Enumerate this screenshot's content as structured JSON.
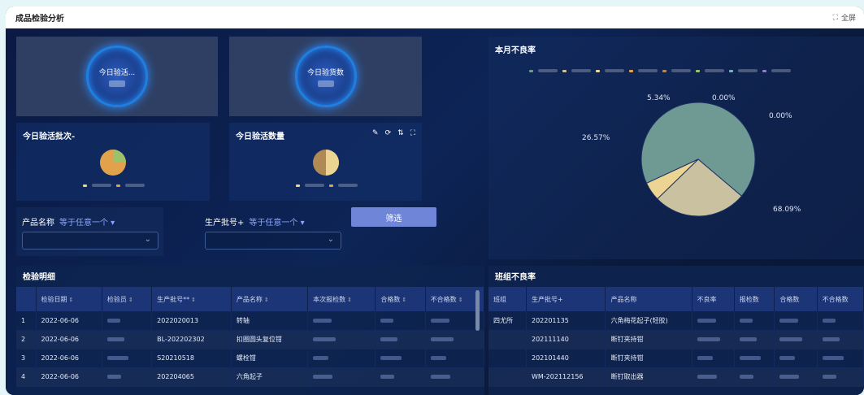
{
  "app": {
    "title": "成品检验分析",
    "fullscreen": "全屏"
  },
  "kpi": {
    "card1": "今日验活...",
    "card2": "今日验货数"
  },
  "charts": {
    "batch_title": "今日验活批次-",
    "qty_title": "今日验活数量"
  },
  "filters": {
    "product_label": "产品名称",
    "product_op": "等于任意一个 ▾",
    "batch_label": "生产批号+",
    "batch_op": "等于任意一个 ▾",
    "button": "筛选"
  },
  "colors": {
    "teal": "#6f9a93",
    "beige": "#c9c1a0",
    "yellow": "#ecd593",
    "orange": "#e2a24c",
    "green": "#9dc06a",
    "brown": "#b08a55"
  },
  "defect_month": {
    "title": "本月不良率"
  },
  "chart_data": [
    {
      "type": "pie",
      "title": "本月不良率",
      "series": [
        {
          "values": [
            68.09,
            26.57,
            5.34,
            0.0,
            0.0
          ]
        }
      ],
      "labels": [
        "68.09%",
        "26.57%",
        "5.34%",
        "0.00%",
        "0.00%"
      ]
    },
    {
      "type": "pie",
      "title": "今日验活批次-",
      "series": [
        {
          "values": [
            0.8,
            0.2
          ]
        }
      ]
    },
    {
      "type": "pie",
      "title": "今日验活数量",
      "series": [
        {
          "values": [
            0.55,
            0.45
          ]
        }
      ]
    }
  ],
  "detail": {
    "title": "检验明细",
    "headers": [
      "",
      "检验日期",
      "检验员",
      "生产批号**",
      "产品名称",
      "本次报检数",
      "合格数",
      "不合格数"
    ],
    "rows": [
      [
        "1",
        "2022-06-06",
        "",
        "2022020013",
        "转轴"
      ],
      [
        "2",
        "2022-06-06",
        "",
        "BL-202202302",
        "扣圈圆头复位钳"
      ],
      [
        "3",
        "2022-06-06",
        "",
        "S20210518",
        "螺栓钳"
      ],
      [
        "4",
        "2022-06-06",
        "",
        "202204065",
        "六角起子"
      ]
    ]
  },
  "team": {
    "title": "班组不良率",
    "headers": [
      "班组",
      "生产批号+",
      "产品名称",
      "不良率",
      "报检数",
      "合格数",
      "不合格数"
    ],
    "rows": [
      [
        "四尤所",
        "202201135",
        "六角梅花起子(轻胶)"
      ],
      [
        "",
        "202111140",
        "断钉夹持钳"
      ],
      [
        "",
        "202101440",
        "断钉夹持钳"
      ],
      [
        "",
        "WM-202112156",
        "断钉取出器"
      ]
    ]
  }
}
